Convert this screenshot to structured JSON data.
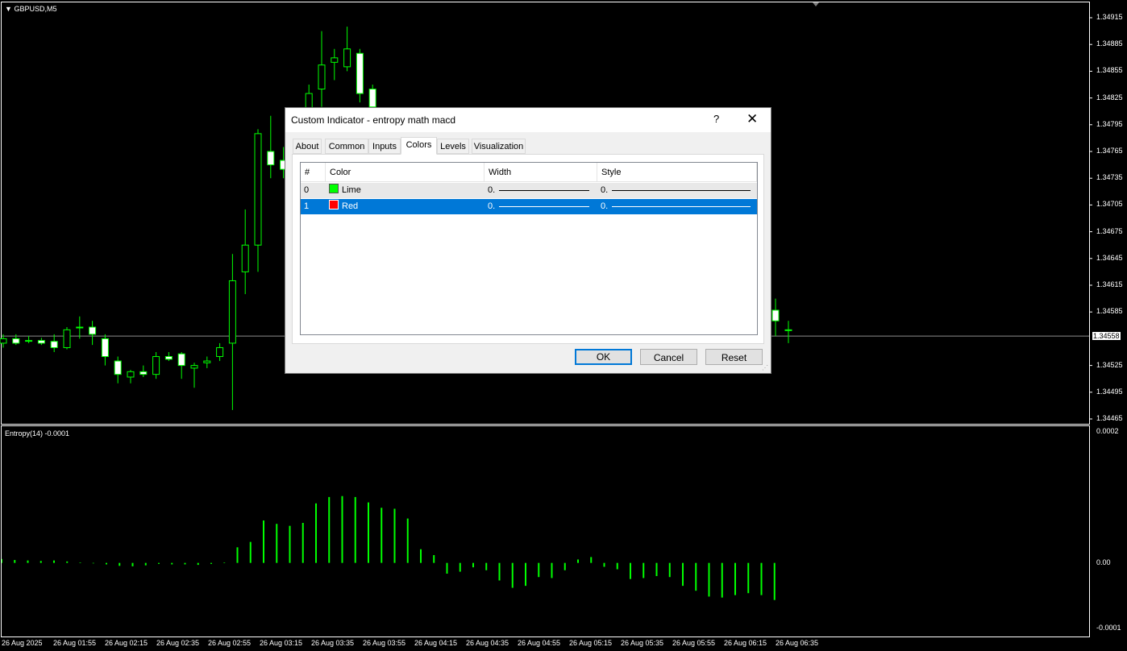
{
  "chart": {
    "symbol_label": "GBPUSD,M5",
    "current_price": "1.34558",
    "price_axis": [
      "1.34915",
      "1.34885",
      "1.34855",
      "1.34825",
      "1.34795",
      "1.34765",
      "1.34735",
      "1.34705",
      "1.34675",
      "1.34645",
      "1.34615",
      "1.34585",
      "1.34525",
      "1.34495",
      "1.34465"
    ],
    "indicator_label": "Entropy(14) -0.0001",
    "indicator_axis": [
      "0.0002",
      "0.00",
      "-0.0001"
    ],
    "time_axis": [
      "26 Aug 2025",
      "26 Aug 01:55",
      "26 Aug 02:15",
      "26 Aug 02:35",
      "26 Aug 02:55",
      "26 Aug 03:15",
      "26 Aug 03:35",
      "26 Aug 03:55",
      "26 Aug 04:15",
      "26 Aug 04:35",
      "26 Aug 04:55",
      "26 Aug 05:15",
      "26 Aug 05:35",
      "26 Aug 05:55",
      "26 Aug 06:15",
      "26 Aug 06:35"
    ],
    "colors": {
      "background": "#000000",
      "candle_bull": "#000000",
      "candle_bear": "#ffffff",
      "wick": "#00ff00",
      "histogram": "#00ff00"
    },
    "candles": [
      [
        1.3455,
        1.3456,
        1.34545,
        1.34555
      ],
      [
        1.34555,
        1.3456,
        1.34548,
        1.3455
      ],
      [
        1.34553,
        1.34558,
        1.3455,
        1.34553
      ],
      [
        1.34553,
        1.34556,
        1.34548,
        1.3455
      ],
      [
        1.34552,
        1.3456,
        1.3454,
        1.34545
      ],
      [
        1.34545,
        1.34568,
        1.34543,
        1.34565
      ],
      [
        1.34568,
        1.3458,
        1.34555,
        1.34568
      ],
      [
        1.34568,
        1.34575,
        1.34548,
        1.3456
      ],
      [
        1.34555,
        1.3456,
        1.34525,
        1.34535
      ],
      [
        1.3453,
        1.34535,
        1.34505,
        1.34515
      ],
      [
        1.34512,
        1.3452,
        1.34505,
        1.34518
      ],
      [
        1.34518,
        1.34525,
        1.34512,
        1.34515
      ],
      [
        1.34515,
        1.3454,
        1.3451,
        1.34535
      ],
      [
        1.34535,
        1.3454,
        1.3453,
        1.34532
      ],
      [
        1.34538,
        1.3454,
        1.3451,
        1.34525
      ],
      [
        1.34522,
        1.34528,
        1.345,
        1.34525
      ],
      [
        1.34528,
        1.34535,
        1.34522,
        1.3453
      ],
      [
        1.34535,
        1.3455,
        1.3453,
        1.34545
      ],
      [
        1.3455,
        1.3465,
        1.34475,
        1.3462
      ],
      [
        1.3463,
        1.347,
        1.34605,
        1.3466
      ],
      [
        1.3466,
        1.3479,
        1.3463,
        1.34785
      ],
      [
        1.34765,
        1.34805,
        1.34735,
        1.3475
      ],
      [
        1.34755,
        1.3477,
        1.34735,
        1.34745
      ],
      [
        1.34755,
        1.3479,
        1.3474,
        1.34765
      ],
      [
        1.34775,
        1.3484,
        1.3476,
        1.3483
      ],
      [
        1.34835,
        1.349,
        1.34815,
        1.34862
      ],
      [
        1.34865,
        1.3488,
        1.34845,
        1.3487
      ],
      [
        1.3486,
        1.34905,
        1.34855,
        1.3488
      ],
      [
        1.34875,
        1.3488,
        1.3482,
        1.3483
      ],
      [
        1.34835,
        1.3484,
        1.348,
        1.34815
      ]
    ],
    "tail_candles": [
      [
        1.34587,
        1.346,
        1.34558,
        1.34575
      ],
      [
        1.34565,
        1.34575,
        1.3455,
        1.34565
      ]
    ],
    "entropy": [
      8e-07,
      6e-07,
      5e-07,
      4e-07,
      5e-07,
      3e-07,
      1e-07,
      -1e-07,
      -3e-07,
      -6e-07,
      -7e-07,
      -5e-07,
      -2e-07,
      -3e-07,
      -3e-07,
      -4e-07,
      -2e-07,
      1e-07,
      3.2e-06,
      4.3e-06,
      8.7e-06,
      8e-06,
      7.6e-06,
      8.2e-06,
      1.22e-05,
      1.35e-05,
      1.37e-05,
      1.35e-05,
      1.24e-05,
      1.13e-05,
      1.11e-05,
      9.1e-06,
      2.8e-06,
      1.6e-06,
      -2.2e-06,
      -1.8e-06,
      -9e-07,
      -1.5e-06,
      -3.6e-06,
      -5.1e-06,
      -4.7e-06,
      -2.9e-06,
      -3.1e-06,
      -1.5e-06,
      7e-07,
      1.2e-06,
      -8e-07,
      -1.3e-06,
      -3.3e-06,
      -3.1e-06,
      -2.7e-06,
      -2.9e-06,
      -4.7e-06,
      -5.7e-06,
      -6.9e-06,
      -7.1e-06,
      -6.6e-06,
      -6.2e-06,
      -6.6e-06,
      -7.6e-06
    ]
  },
  "dialog": {
    "title": "Custom Indicator - entropy math macd",
    "help": "?",
    "close": "✕",
    "tabs": [
      "About",
      "Common",
      "Inputs",
      "Colors",
      "Levels",
      "Visualization"
    ],
    "active_tab": "Colors",
    "columns": [
      "#",
      "Color",
      "Width",
      "Style"
    ],
    "rows": [
      {
        "index": "0",
        "color_name": "Lime",
        "color": "#00ff00",
        "width": "0.",
        "style": "0."
      },
      {
        "index": "1",
        "color_name": "Red",
        "color": "#ff0000",
        "width": "0.",
        "style": "0."
      }
    ],
    "selected_row": 1,
    "buttons": {
      "ok": "OK",
      "cancel": "Cancel",
      "reset": "Reset"
    }
  }
}
